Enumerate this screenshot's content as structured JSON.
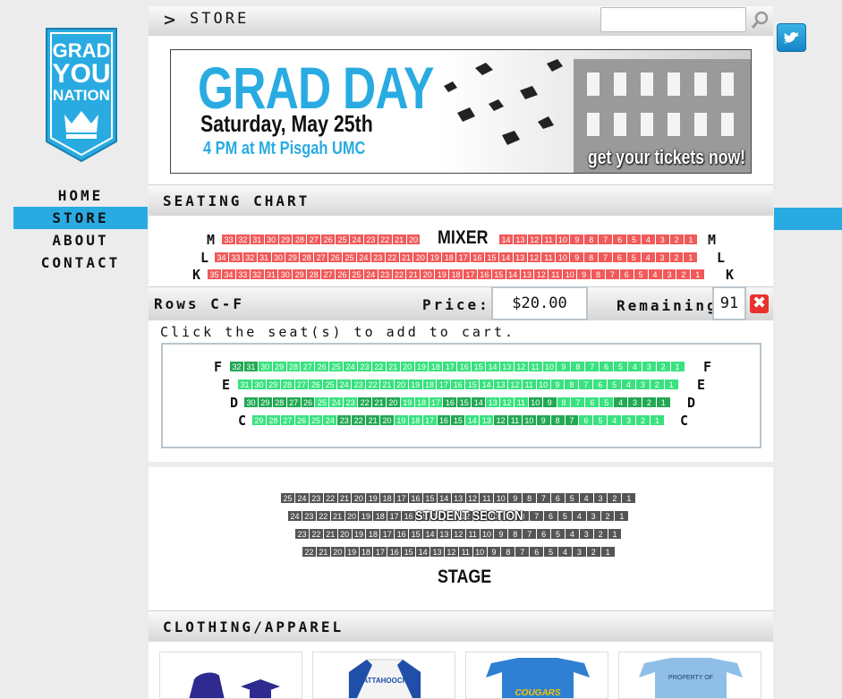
{
  "logo": {
    "line1": "GRAD",
    "line2": "YOU",
    "line3": "NATION"
  },
  "nav": {
    "items": [
      {
        "label": "HOME"
      },
      {
        "label": "STORE"
      },
      {
        "label": "ABOUT"
      },
      {
        "label": "CONTACT"
      }
    ]
  },
  "header": {
    "arrow": ">",
    "breadcrumb": "STORE",
    "search_value": ""
  },
  "banner": {
    "title": "GRAD DAY",
    "date": "Saturday, May 25th",
    "time": "4 PM at Mt Pisgah UMC",
    "cta": "get your tickets now!"
  },
  "colors": {
    "accent": "#29abe2",
    "sold": "#f15a5a",
    "available": "#39e27f",
    "taken": "#23a853",
    "student": "#555555"
  },
  "sections": {
    "seating": "SEATING CHART",
    "clothing": "CLOTHING/APPAREL"
  },
  "mixer_label": "MIXER",
  "pricing": {
    "rows_label": "Rows C-F",
    "price_label": "Price:",
    "price": "$20.00",
    "remaining_label": "Remaining:",
    "remaining": "91",
    "hint": "Click the seat(s) to add to cart."
  },
  "student_label": "STUDENT SECTION",
  "stage_label": "STAGE",
  "products": [
    {
      "icon": "graduation-gown-icon"
    },
    {
      "icon": "raglan-shirt-icon",
      "text": "CHATTAHOOCHEE"
    },
    {
      "icon": "blue-tshirt-icon",
      "text": "COUGARS"
    },
    {
      "icon": "lightblue-tshirt-icon",
      "text": "PROPERTY OF"
    }
  ]
}
